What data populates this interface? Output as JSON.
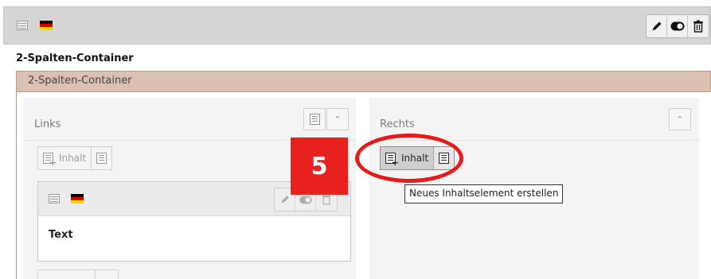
{
  "header": {
    "page_icon": "page-layout-icon",
    "language_flag": "flag-de-icon",
    "controls": [
      {
        "icon": "pencil-icon"
      },
      {
        "icon": "toggle-icon"
      },
      {
        "icon": "trash-icon"
      }
    ]
  },
  "section_title": "2-Spalten-Container",
  "container": {
    "label": "2-Spalten-Container",
    "columns": {
      "left": {
        "title": "Links",
        "new_content_label": "Inhalt",
        "collapse_icon": "chevron-up-icon",
        "paste_icon": "paste-icon",
        "element": {
          "type_icon": "text-element-icon",
          "flag": "flag-de-icon",
          "title": "Text"
        }
      },
      "right": {
        "title": "Rechts",
        "new_content_label": "Inhalt",
        "collapse_icon": "chevron-up-icon",
        "tooltip": "Neues Inhaltselement erstellen"
      }
    }
  },
  "annotation": {
    "step_number": "5",
    "badge_color": "#e8201f",
    "ring_color": "#e31b1b"
  },
  "colors": {
    "header_bg": "#d5d5d5",
    "container_bar_bg": "#dcc1b2",
    "column_bg": "#f4f4f4"
  }
}
